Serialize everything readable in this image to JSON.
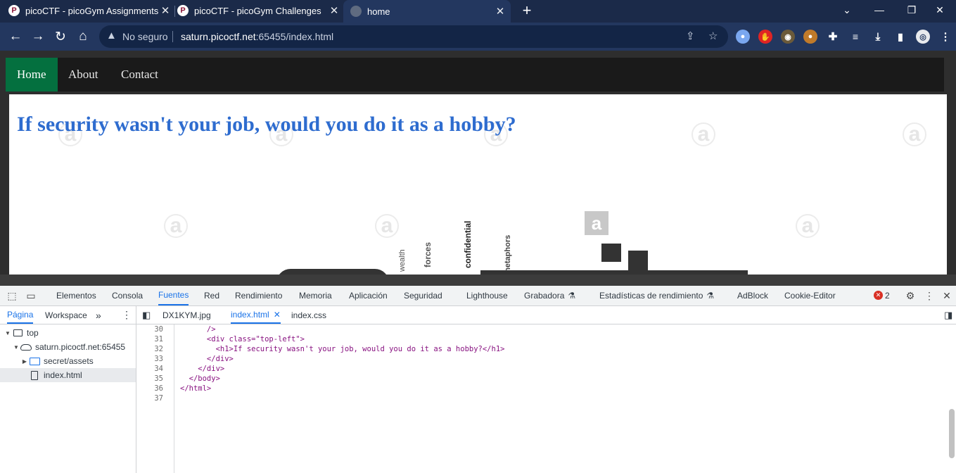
{
  "browser": {
    "tabs": [
      {
        "title": "picoCTF - picoGym Assignments",
        "favicon": "P"
      },
      {
        "title": "picoCTF - picoGym Challenges",
        "favicon": "P"
      },
      {
        "title": "home",
        "favicon": "globe"
      }
    ],
    "window_controls": {
      "dropdown": "⌄",
      "minimize": "—",
      "restore": "❐",
      "close": "✕"
    },
    "address_bar": {
      "security_label": "No seguro",
      "url_host": "saturn.picoctf.net",
      "url_rest": ":65455/index.html"
    },
    "colors": {
      "frame": "#1b2a49",
      "toolbar": "#23375f"
    }
  },
  "page": {
    "nav": [
      {
        "label": "Home",
        "active": true
      },
      {
        "label": "About",
        "active": false
      },
      {
        "label": "Contact",
        "active": false
      }
    ],
    "heading": "If security wasn't your job, would you do it as a hobby?",
    "image_words": [
      "wealth",
      "forces",
      "confidential",
      "metaphors"
    ],
    "colors": {
      "nav_active": "#04703f",
      "heading": "#2e6ccf"
    }
  },
  "devtools": {
    "tabs": [
      "Elementos",
      "Consola",
      "Fuentes",
      "Red",
      "Rendimiento",
      "Memoria",
      "Aplicación",
      "Seguridad",
      "Lighthouse",
      "Grabadora",
      "Estadísticas de rendimiento",
      "AdBlock",
      "Cookie-Editor"
    ],
    "active_tab": "Fuentes",
    "error_count": "2",
    "navigator_tabs": [
      "Página",
      "Workspace"
    ],
    "tree": [
      {
        "label": "top",
        "icon": "frame-icon"
      },
      {
        "label": "saturn.picoctf.net:65455",
        "icon": "cloud-icon"
      },
      {
        "label": "secret/assets",
        "icon": "folder-icon"
      },
      {
        "label": "index.html",
        "icon": "file-icon"
      }
    ],
    "editor_tabs": [
      {
        "label": "DX1KYM.jpg",
        "active": false
      },
      {
        "label": "index.html",
        "active": true
      },
      {
        "label": "index.css",
        "active": false
      }
    ],
    "code_lines": [
      {
        "n": "30",
        "text": "      />"
      },
      {
        "n": "31",
        "text": "      <div class=\"top-left\">"
      },
      {
        "n": "32",
        "text": "        <h1>If security wasn't your job, would you do it as a hobby?</h1>"
      },
      {
        "n": "33",
        "text": "      </div>"
      },
      {
        "n": "34",
        "text": "    </div>"
      },
      {
        "n": "35",
        "text": "  </body>"
      },
      {
        "n": "36",
        "text": "</html>"
      },
      {
        "n": "37",
        "text": ""
      }
    ]
  }
}
